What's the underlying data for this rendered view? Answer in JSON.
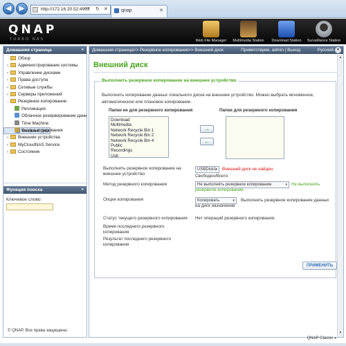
{
  "browser": {
    "url": "http://172.16.20.52:4903",
    "tab_title": "qnap"
  },
  "header": {
    "logo": "QNAP",
    "logo_sub": "TURBO NAS",
    "apps": [
      {
        "label": "Web File Manager",
        "icon": "folder-globe-icon",
        "color": "#d9a23a"
      },
      {
        "label": "Multimedia Station",
        "icon": "film-icon",
        "color": "#8a5a2c"
      },
      {
        "label": "Download Station",
        "icon": "download-icon",
        "color": "#3a6fd1"
      },
      {
        "label": "Surveillance Station",
        "icon": "camera-icon",
        "color": "#9aa0a6"
      }
    ]
  },
  "left_panel": {
    "title": "Домашняя страница",
    "toggle": "«",
    "tree": [
      {
        "label": "Обзор",
        "kind": "folder",
        "level": 0,
        "exp": ""
      },
      {
        "label": "Администрирование системы",
        "kind": "folder",
        "level": 0,
        "exp": "+"
      },
      {
        "label": "Управление дисками",
        "kind": "folder",
        "level": 0,
        "exp": "+"
      },
      {
        "label": "Права доступа",
        "kind": "folder",
        "level": 0,
        "exp": "+"
      },
      {
        "label": "Сетевые службы",
        "kind": "folder",
        "level": 0,
        "exp": "+"
      },
      {
        "label": "Серверы приложений",
        "kind": "folder",
        "level": 0,
        "exp": "+"
      },
      {
        "label": "Резервное копирование",
        "kind": "folder",
        "level": 0,
        "exp": "−"
      },
      {
        "label": "Репликация",
        "kind": "leaf",
        "level": 1,
        "color": "#6ea34a"
      },
      {
        "label": "Облачное резервирование данн",
        "kind": "leaf",
        "level": 1,
        "color": "#5a8fd0"
      },
      {
        "label": "Time Machine",
        "kind": "leaf",
        "level": 1,
        "color": "#888888"
      },
      {
        "label": "Внешний диск",
        "kind": "leaf",
        "level": 1,
        "color": "#6b7c94",
        "selected": true
      },
      {
        "label": "Кнопка копирования",
        "kind": "leaf",
        "level": 1,
        "color": "#c2a24a"
      },
      {
        "label": "Внешние устройства",
        "kind": "folder",
        "level": 0,
        "exp": "+"
      },
      {
        "label": "MyCloudNAS Service",
        "kind": "folder",
        "level": 0,
        "exp": "+"
      },
      {
        "label": "Состояние",
        "kind": "folder",
        "level": 0,
        "exp": "+"
      }
    ],
    "search_title": "Функция поиска",
    "search_toggle": "«",
    "search_label": "Ключевое слово:",
    "footer": "© QNAP, Все права защищены"
  },
  "topbar": {
    "breadcrumb": "Домашняя страница>> Резервное копирование>> Внешний диск",
    "greeting": "Приветствуем, admin | Выход",
    "language": "Русский"
  },
  "page": {
    "title": "Внешний диск",
    "section_title": "Выполнить резервное копирование на внешнее устройство",
    "description": "Выполнить копирование данных локального диска на внешнее устройство. Можно выбрать мгновенное, автоматическое или плановое копирование.",
    "left_list_title": "Папки не для резервного копирования",
    "right_list_title": "Папки для резервного копирования",
    "left_list": [
      "Download",
      "Multimedia",
      "Network Recycle Bin 1",
      "Network Recycle Bin 2",
      "Network Recycle Bin 4",
      "Public",
      "Recordings",
      "Usb",
      "Web"
    ],
    "right_list": [],
    "add_arrow": "→",
    "remove_arrow": "←",
    "dest_label": "Выполнить резервное копирование на внешнее устройство:",
    "dest_value": "USBDisk1",
    "dest_error": "Внешний диск не найден.",
    "free_total": "Свободно/Всего:",
    "method_label": "Метод резервного копирования",
    "method_value": "Не выполнять резервное копирование",
    "method_warning": "Не выполнять резервное копирование.",
    "option_label": "Опция копирования",
    "option_value": "Копировать",
    "option_desc": "Выполнить резервное копирование данных на диск назначения",
    "status_label": "Статус текущего резервного копирования",
    "status_value": "Нет операций резервного копирования.",
    "last_time_label": "Время последнего резервного копирования",
    "last_result_label": "Результат последнего резервного копирования",
    "apply": "ПРИМЕНИТЬ"
  },
  "footer_right": "QNAP Classic"
}
